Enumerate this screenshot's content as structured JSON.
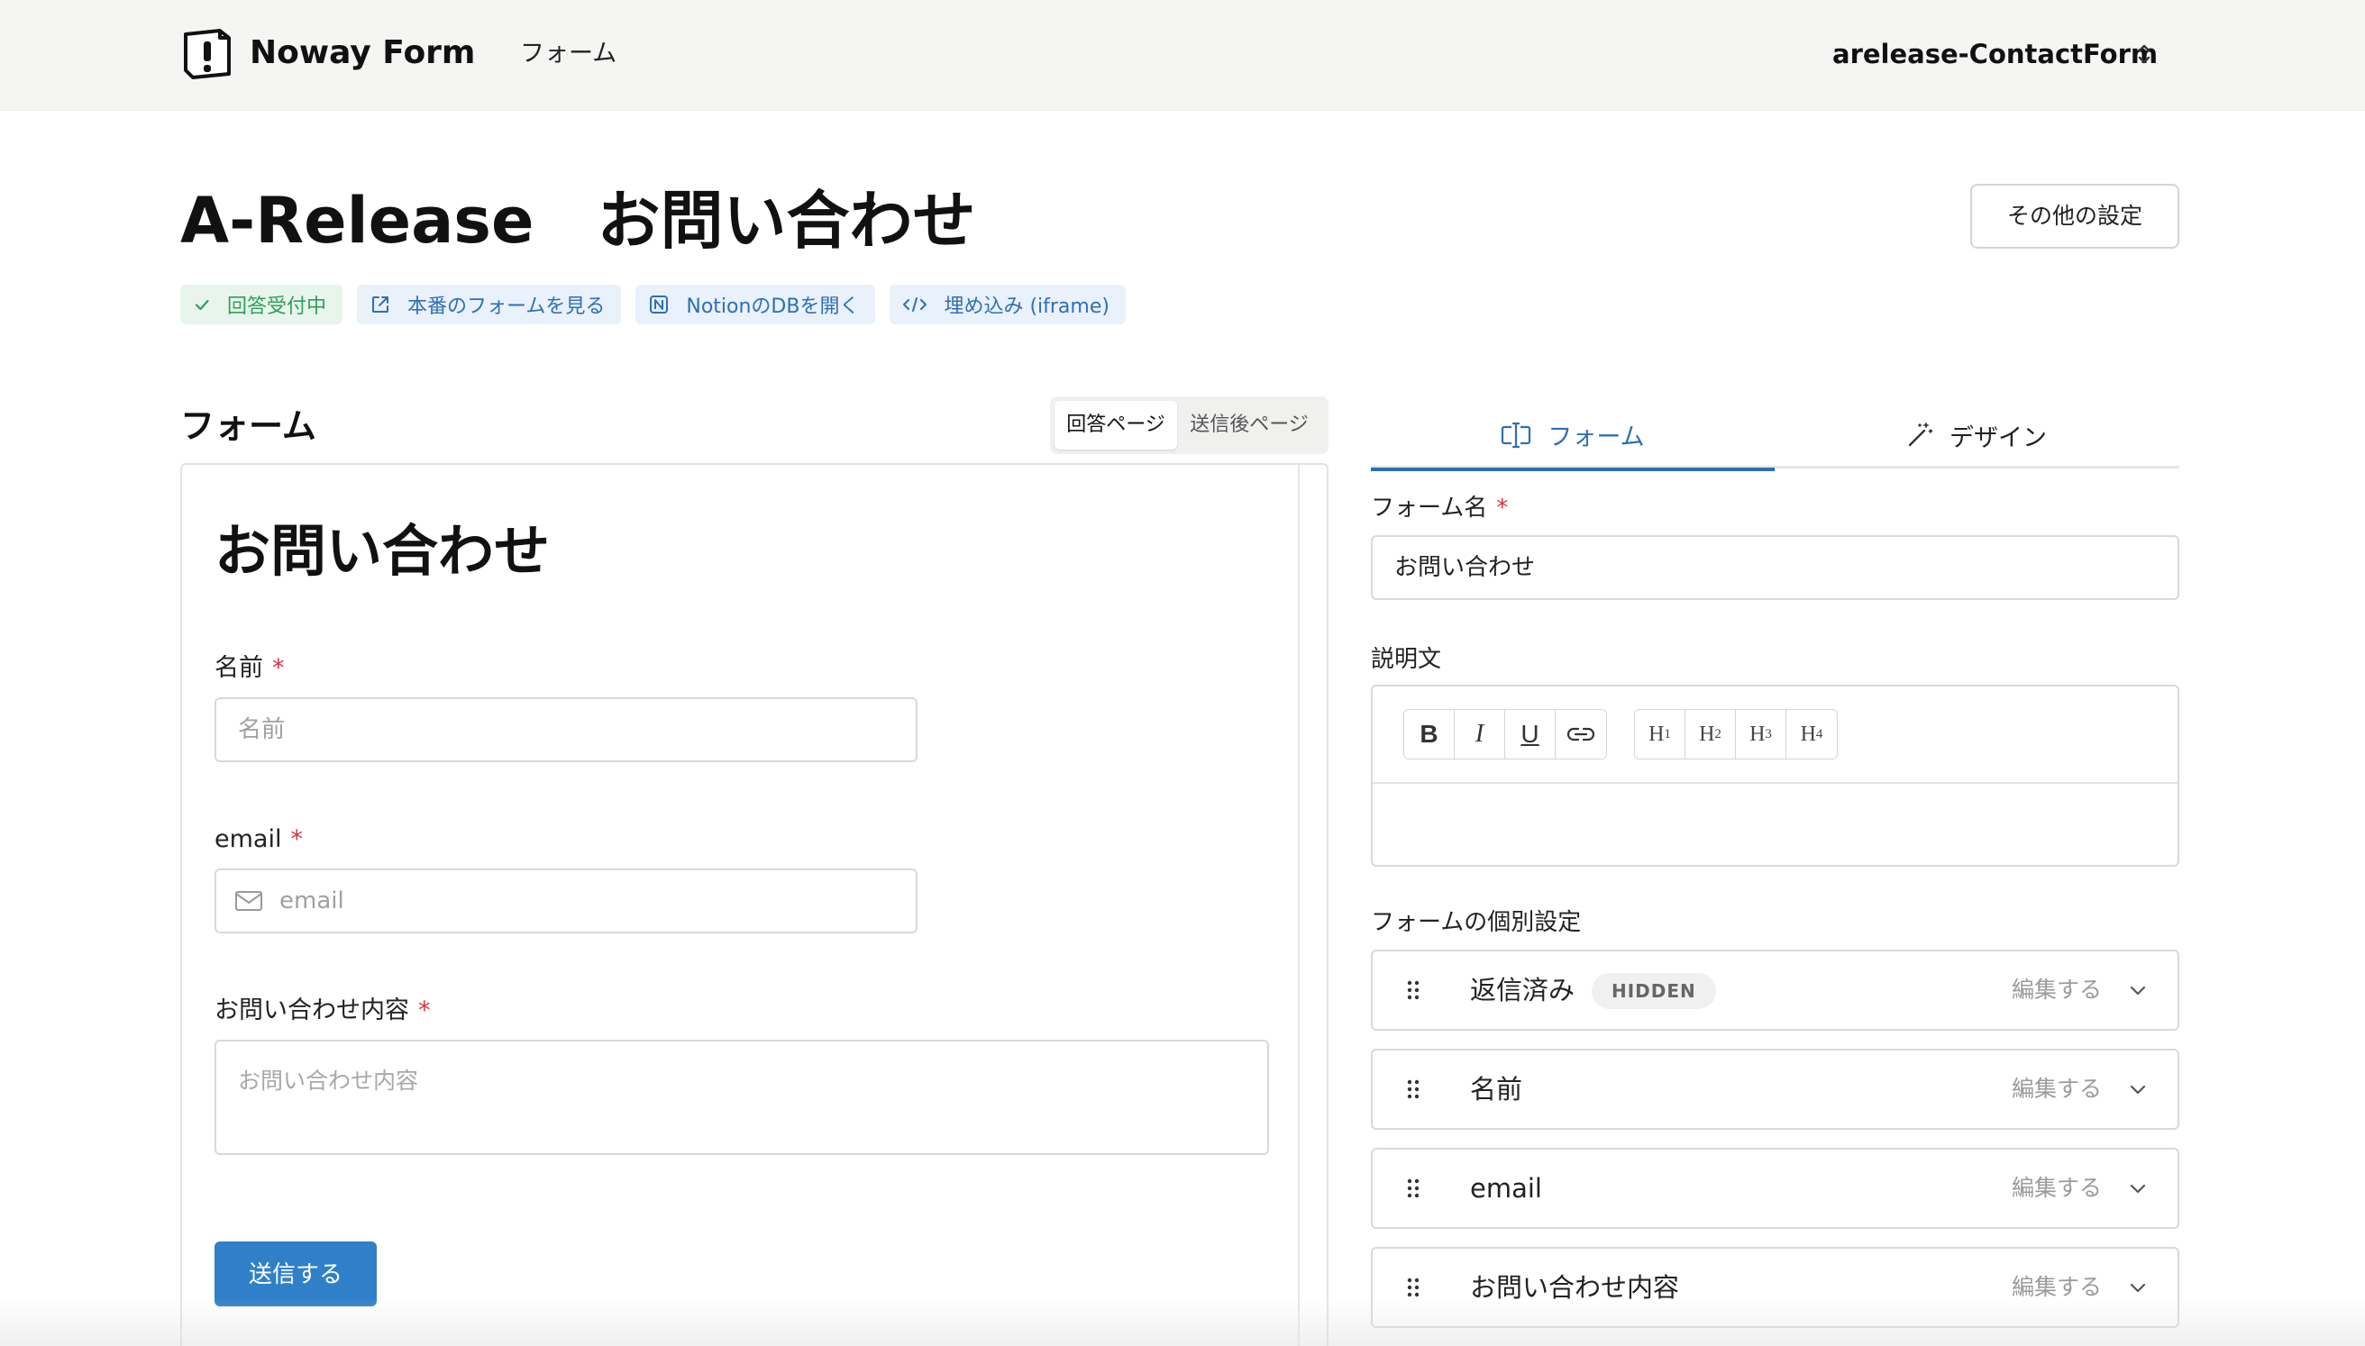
{
  "header": {
    "brand": "Noway Form",
    "nav_form": "フォーム",
    "workspace": "arelease-ContactForm"
  },
  "page": {
    "title": "A-Release　お問い合わせ",
    "other_settings": "その他の設定",
    "chips": {
      "accepting": "回答受付中",
      "view_form": "本番のフォームを見る",
      "open_db": "NotionのDBを開く",
      "embed": "埋め込み (iframe)"
    }
  },
  "left": {
    "section_title": "フォーム",
    "segment": {
      "answer_page": "回答ページ",
      "after_submit_page": "送信後ページ"
    },
    "preview": {
      "title": "お問い合わせ",
      "required_mark": "*",
      "fields": [
        {
          "label": "名前",
          "placeholder": "名前"
        },
        {
          "label": "email",
          "placeholder": "email"
        },
        {
          "label": "お問い合わせ内容",
          "placeholder": "お問い合わせ内容"
        }
      ],
      "submit": "送信する"
    }
  },
  "right": {
    "tabs": {
      "form": "フォーム",
      "design": "デザイン"
    },
    "form_name_label": "フォーム名",
    "required_mark": "*",
    "form_name_value": "お問い合わせ",
    "description_label": "説明文",
    "toolbar": {
      "bold": "B",
      "italic": "I",
      "underline": "U",
      "h": "H",
      "h1": "1",
      "h2": "2",
      "h3": "3",
      "h4": "4"
    },
    "field_settings_label": "フォームの個別設定",
    "edit_label": "編集する",
    "fields": [
      {
        "name": "返信済み",
        "badge": "HIDDEN"
      },
      {
        "name": "名前"
      },
      {
        "name": "email"
      },
      {
        "name": "お問い合わせ内容"
      }
    ]
  },
  "colors": {
    "accent": "#2f6fb3",
    "submit": "#2f80c8",
    "required": "#d9333f",
    "accepting_bg": "#e8f5ec",
    "accepting_text": "#2f9e5a"
  },
  "icons": [
    "logo-icon",
    "updown-caret-icon",
    "check-icon",
    "external-link-icon",
    "notion-icon",
    "code-icon",
    "mail-icon",
    "form-input-icon",
    "magic-wand-icon",
    "link-icon",
    "drag-handle-icon",
    "chevron-down-icon"
  ]
}
